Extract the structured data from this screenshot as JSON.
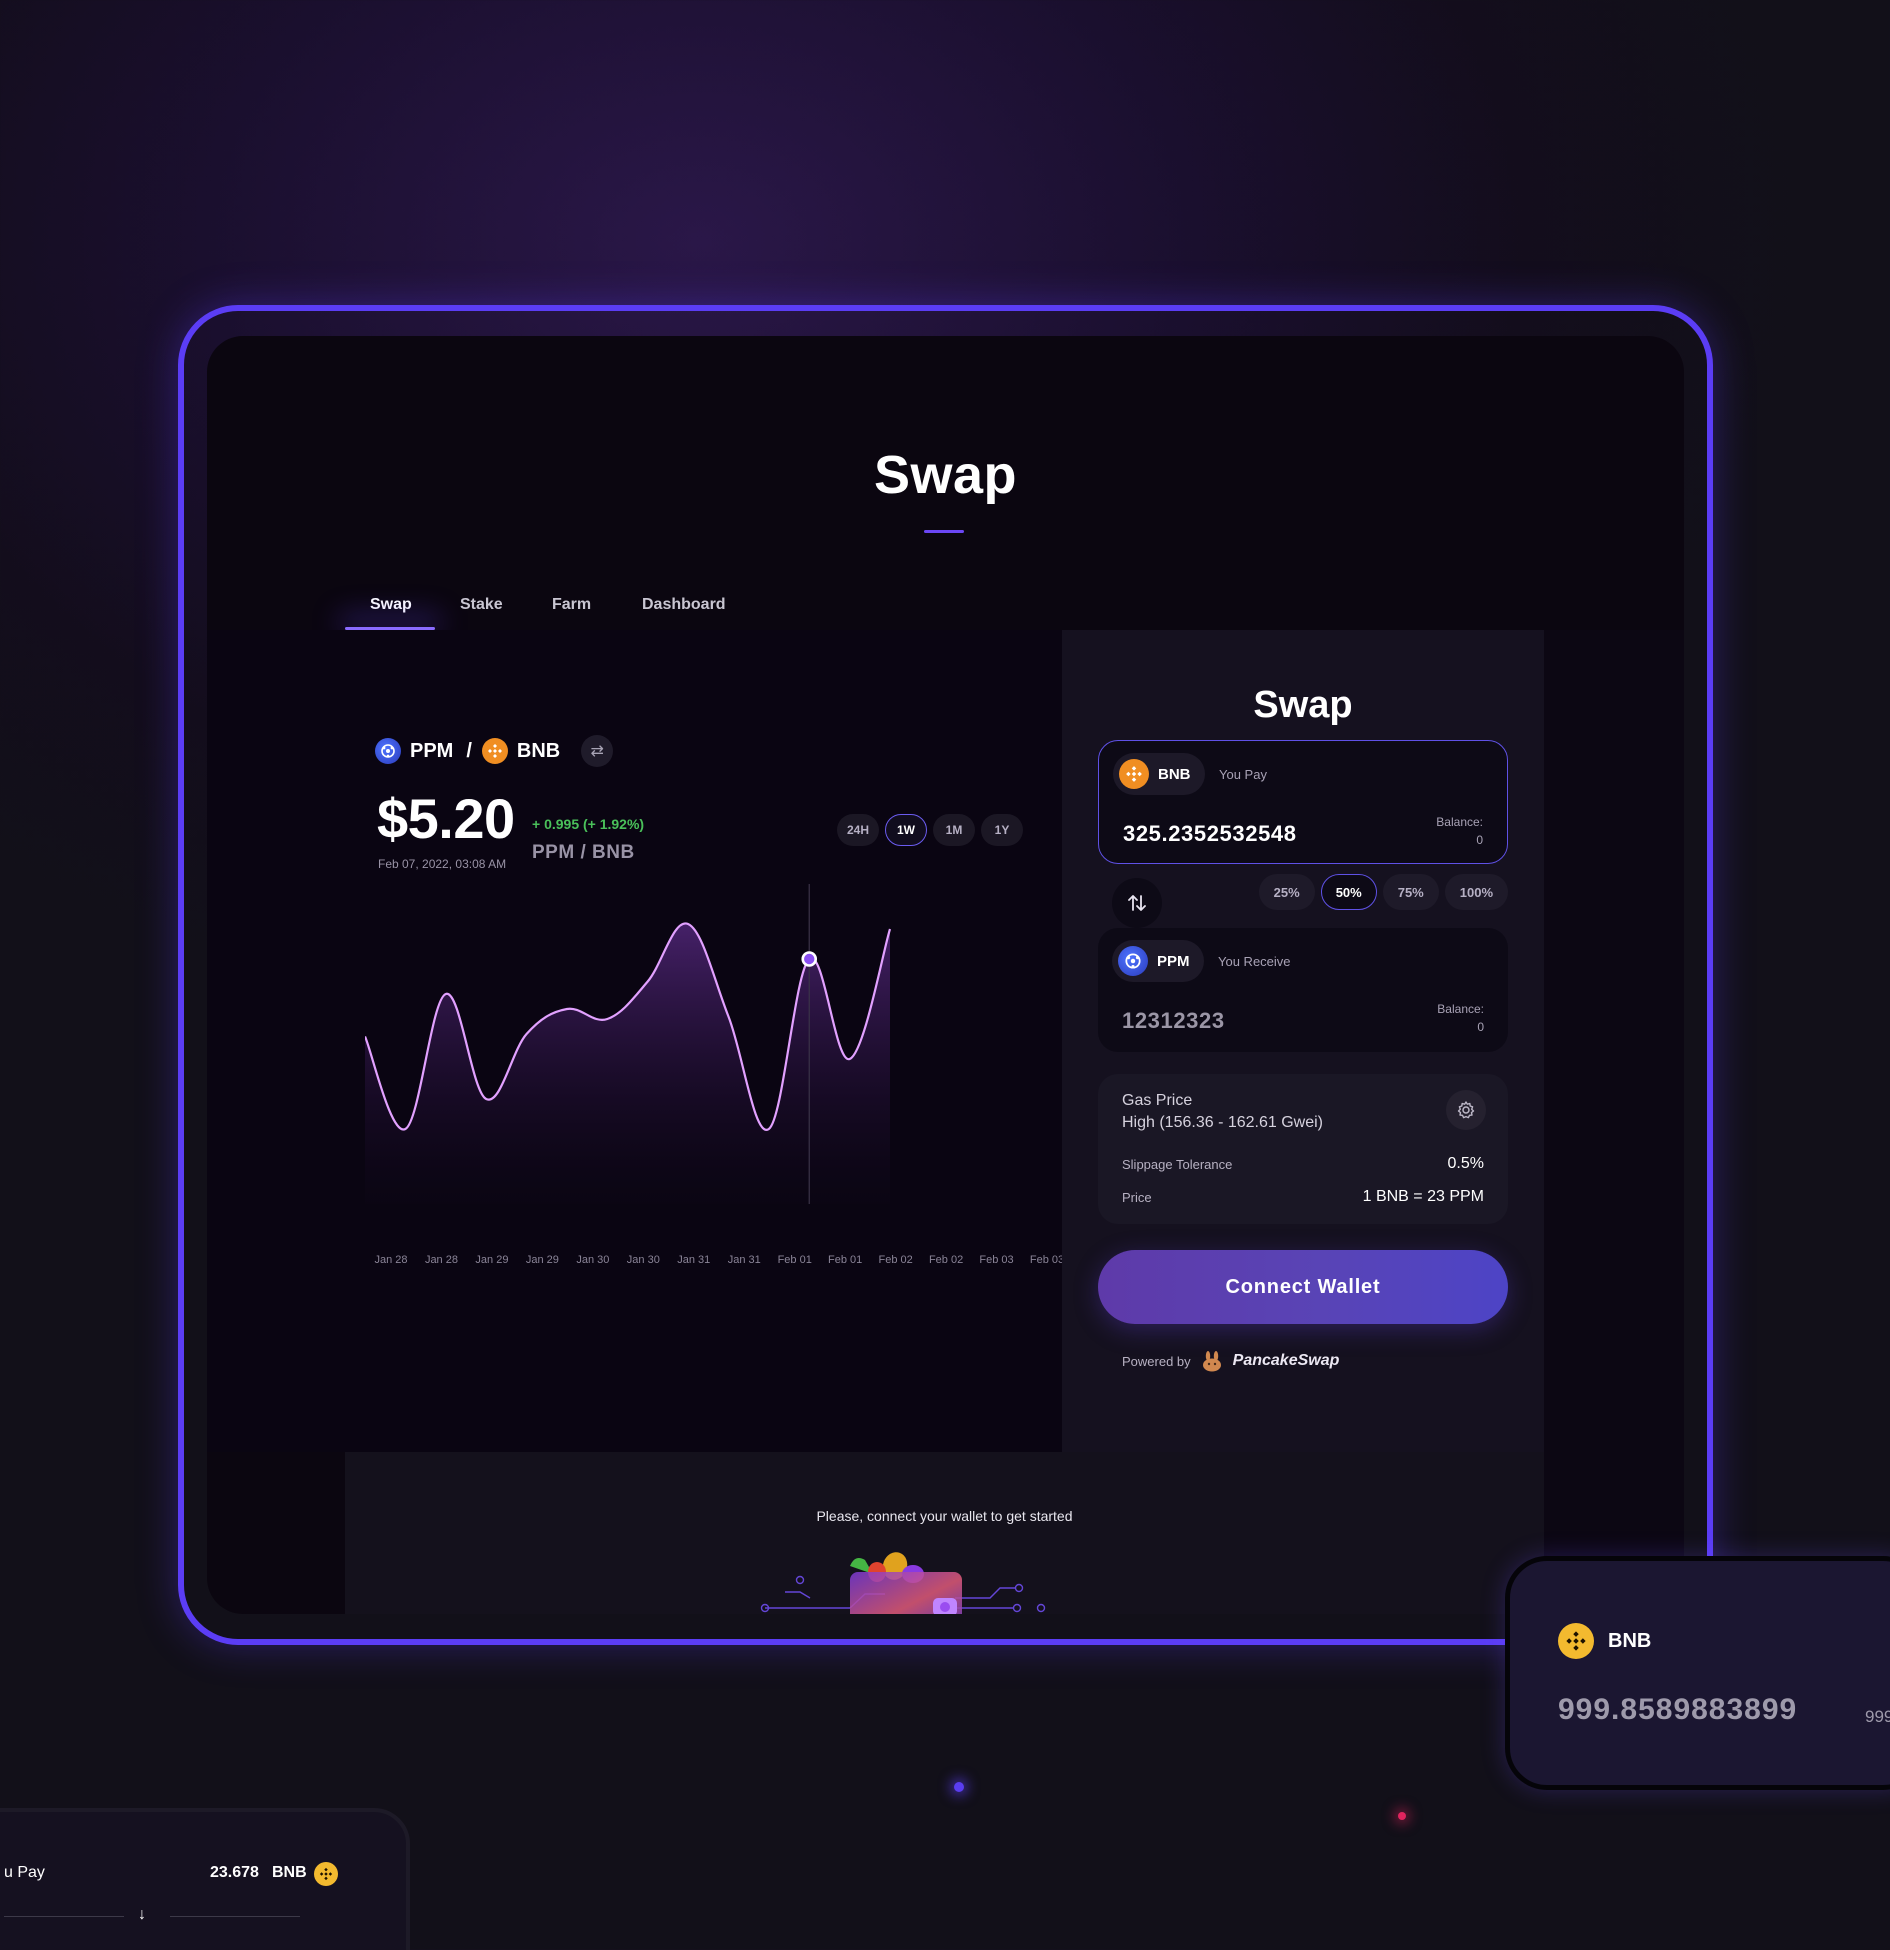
{
  "colors": {
    "accent": "#5b3df5",
    "green": "#4ac05a",
    "bnb": "#f3ba2f",
    "ppm": "#3b55e6",
    "chart_line": "#e2a1ff"
  },
  "page": {
    "title": "Swap"
  },
  "tabs": [
    {
      "label": "Swap",
      "active": true
    },
    {
      "label": "Stake",
      "active": false
    },
    {
      "label": "Farm",
      "active": false
    },
    {
      "label": "Dashboard",
      "active": false
    }
  ],
  "pair": {
    "base": "PPM",
    "separator": "/",
    "quote": "BNB",
    "base_icon": "ppm-token-icon",
    "quote_icon": "bnb-token-icon",
    "swap_icon": "swap-arrows-icon"
  },
  "price": {
    "value": "$5.20",
    "date": "Feb 07, 2022, 03:08 AM",
    "change": "+ 0.995 (+ 1.92%)",
    "pair_label": "PPM / BNB"
  },
  "ranges": [
    {
      "label": "24H",
      "active": false
    },
    {
      "label": "1W",
      "active": true
    },
    {
      "label": "1M",
      "active": false
    },
    {
      "label": "1Y",
      "active": false
    }
  ],
  "chart_data": {
    "type": "area",
    "x": [
      "Jan 28",
      "Jan 28",
      "Jan 29",
      "Jan 29",
      "Jan 30",
      "Jan 30",
      "Jan 31",
      "Jan 31",
      "Feb 01",
      "Feb 01",
      "Feb 02",
      "Feb 02",
      "Feb 03",
      "Feb 03"
    ],
    "series": [
      {
        "values": [
          0.55,
          0.18,
          0.72,
          0.3,
          0.56,
          0.66,
          0.62,
          0.77,
          1.0,
          0.63,
          0.18,
          0.86,
          0.46,
          0.98
        ]
      }
    ],
    "highlight_index": 11,
    "grid": false,
    "legend": "none"
  },
  "swap": {
    "title": "Swap",
    "pay": {
      "token": "BNB",
      "label": "You Pay",
      "amount": "325.2352532548",
      "balance_label": "Balance:",
      "balance_value": "0"
    },
    "receive": {
      "token": "PPM",
      "label": "You Receive",
      "amount": "12312323",
      "balance_label": "Balance:",
      "balance_value": "0"
    },
    "percents": [
      {
        "label": "25%",
        "active": false
      },
      {
        "label": "50%",
        "active": true
      },
      {
        "label": "75%",
        "active": false
      },
      {
        "label": "100%",
        "active": false
      }
    ],
    "gas": {
      "title": "Gas Price",
      "level": "High (156.36 - 162.61 Gwei)",
      "slippage_label": "Slippage Tolerance",
      "slippage_value": "0.5%",
      "price_label": "Price",
      "price_value": "1 BNB = 23 PPM"
    },
    "connect_label": "Connect Wallet",
    "powered_label": "Powered by",
    "powered_name": "PancakeSwap"
  },
  "footer": {
    "message": "Please, connect your wallet to get started"
  },
  "float_card": {
    "token": "BNB",
    "amount": "999.8589883899",
    "amount_partial": "999"
  },
  "mini_card": {
    "label": "u Pay",
    "amount": "23.678",
    "token": "BNB"
  }
}
